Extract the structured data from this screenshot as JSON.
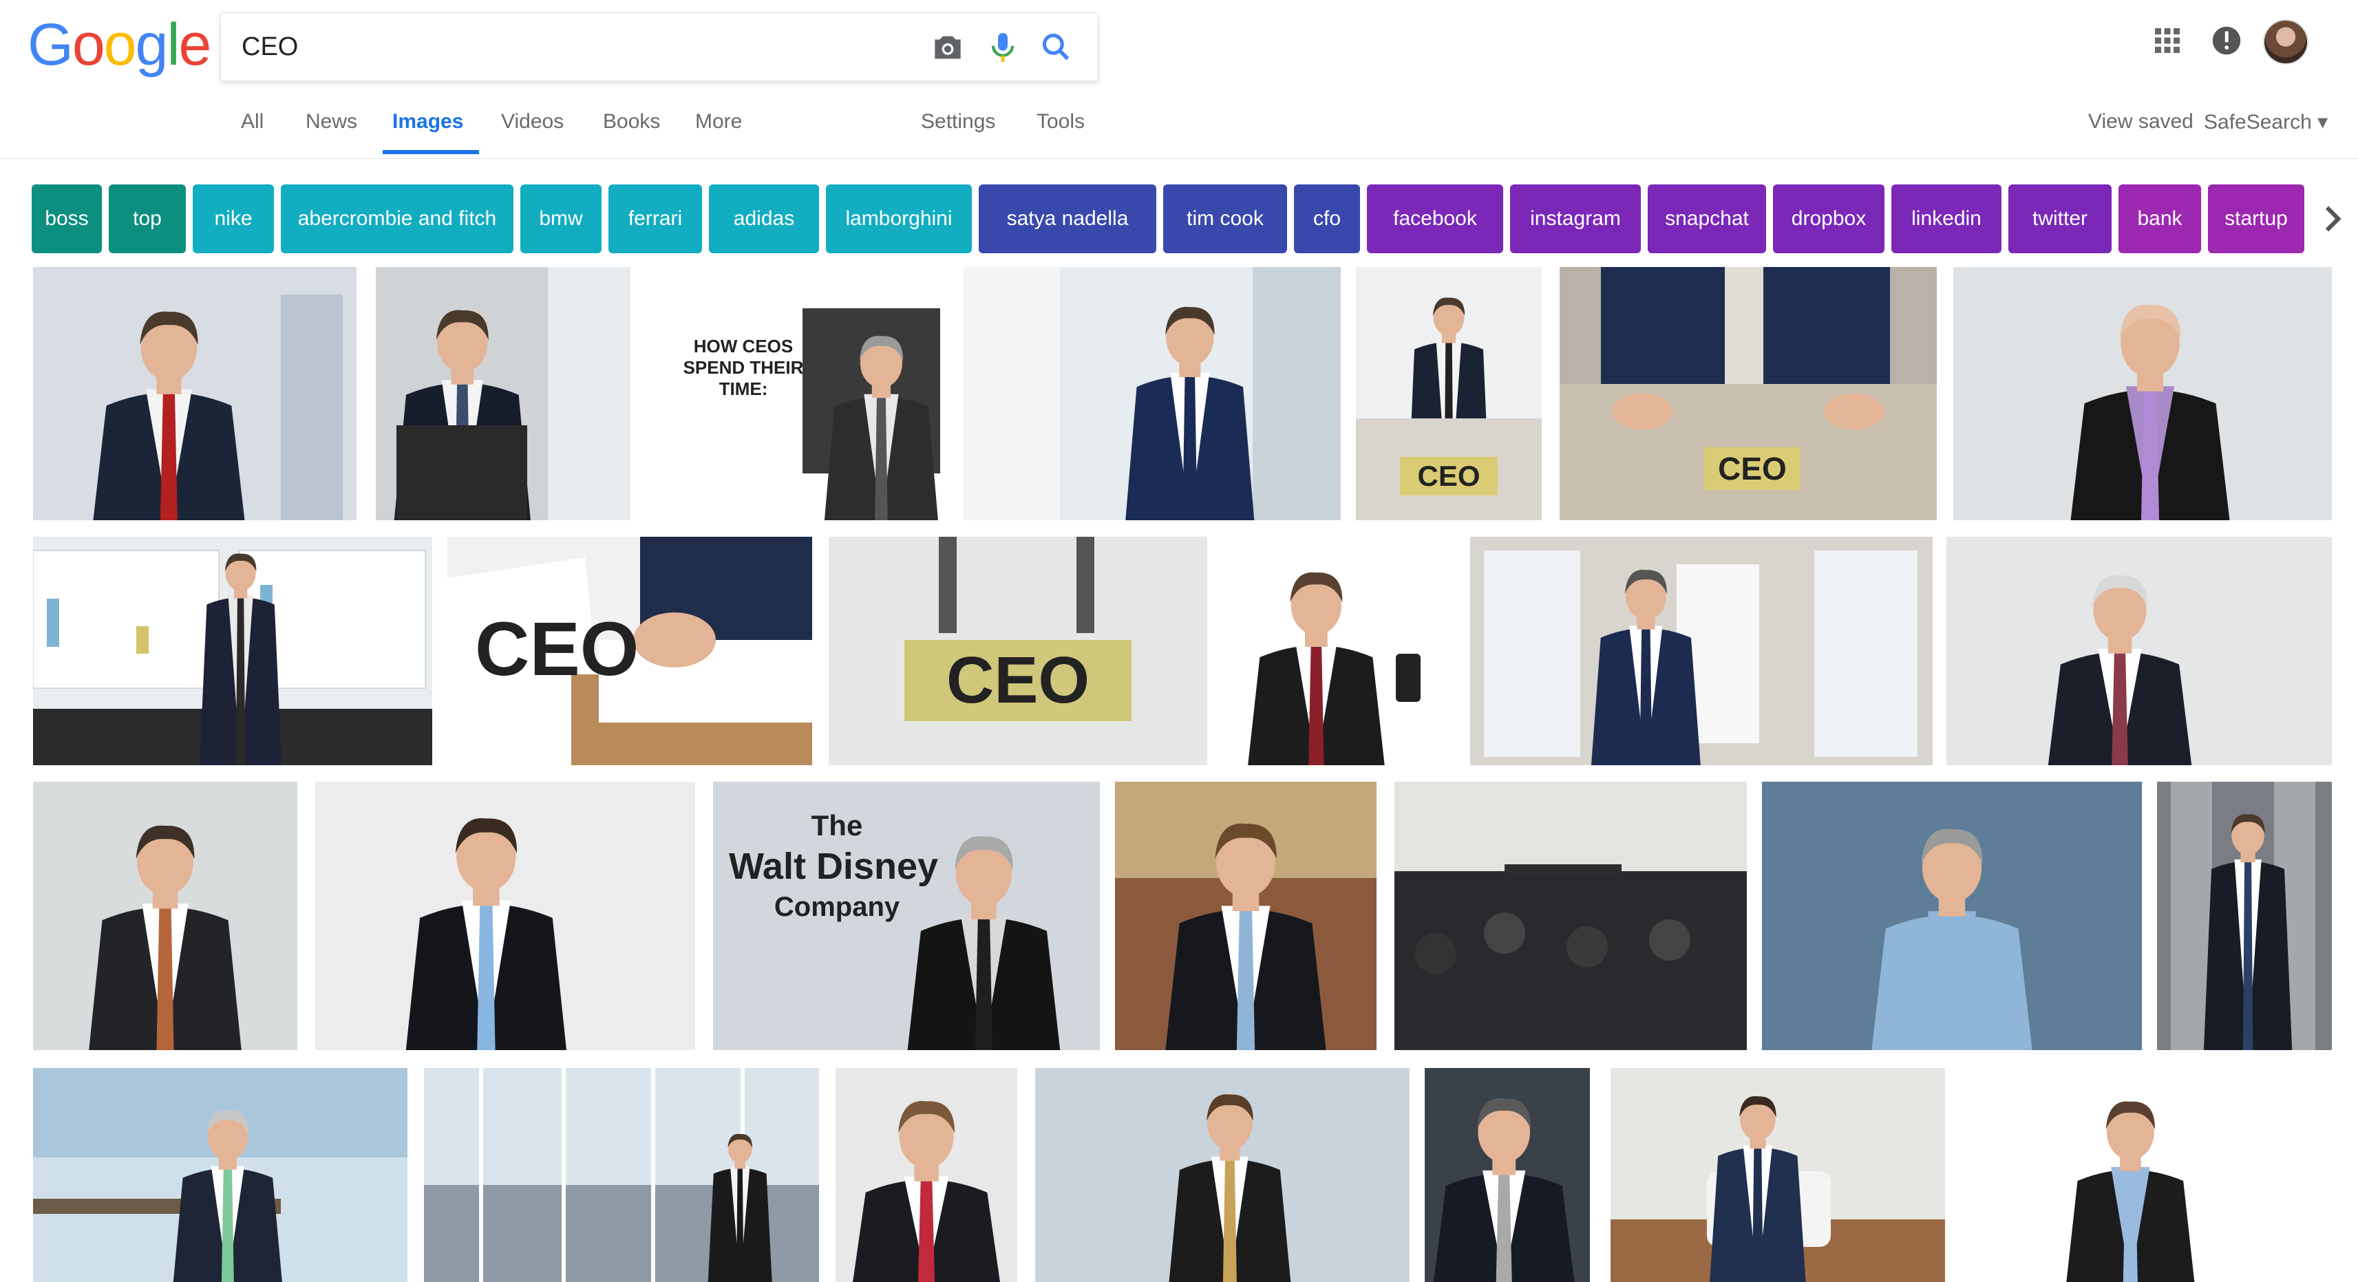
{
  "logo": {
    "letters": [
      "G",
      "o",
      "o",
      "g",
      "l",
      "e"
    ],
    "colors": [
      "#4285F4",
      "#EA4335",
      "#FBBC05",
      "#4285F4",
      "#34A853",
      "#EA4335"
    ]
  },
  "search": {
    "value": "CEO",
    "icons": [
      "camera-icon",
      "microphone-icon",
      "search-icon"
    ]
  },
  "header_right": {
    "icons": [
      "apps-grid-icon",
      "notifications-icon",
      "avatar"
    ]
  },
  "nav": {
    "tabs": [
      "All",
      "News",
      "Images",
      "Videos",
      "Books",
      "More"
    ],
    "active": "Images",
    "tools": [
      "Settings",
      "Tools"
    ],
    "right": [
      "View saved",
      "SafeSearch ▾"
    ]
  },
  "chips": [
    {
      "label": "boss",
      "color": "#0d8f80"
    },
    {
      "label": "top",
      "color": "#0d8f80"
    },
    {
      "label": "nike",
      "color": "#12adc1"
    },
    {
      "label": "abercrombie and fitch",
      "color": "#12adc1"
    },
    {
      "label": "bmw",
      "color": "#12adc1"
    },
    {
      "label": "ferrari",
      "color": "#12adc1"
    },
    {
      "label": "adidas",
      "color": "#12adc1"
    },
    {
      "label": "lamborghini",
      "color": "#12adc1"
    },
    {
      "label": "satya nadella",
      "color": "#3949ab"
    },
    {
      "label": "tim cook",
      "color": "#3949ab"
    },
    {
      "label": "cfo",
      "color": "#3949ab"
    },
    {
      "label": "facebook",
      "color": "#7b27b8"
    },
    {
      "label": "instagram",
      "color": "#7b27b8"
    },
    {
      "label": "snapchat",
      "color": "#7b27b8"
    },
    {
      "label": "dropbox",
      "color": "#7b27b8"
    },
    {
      "label": "linkedin",
      "color": "#7b27b8"
    },
    {
      "label": "twitter",
      "color": "#7b27b8"
    },
    {
      "label": "bank",
      "color": "#9c27b0"
    },
    {
      "label": "startup",
      "color": "#9c27b0"
    }
  ],
  "image_texts": {
    "ceos_time": "HOW CEOS SPEND THEIR TIME:",
    "ceo_sign": "CEO",
    "disney_the": "The",
    "disney_name": "Walt Disney",
    "disney_company": "Company"
  }
}
